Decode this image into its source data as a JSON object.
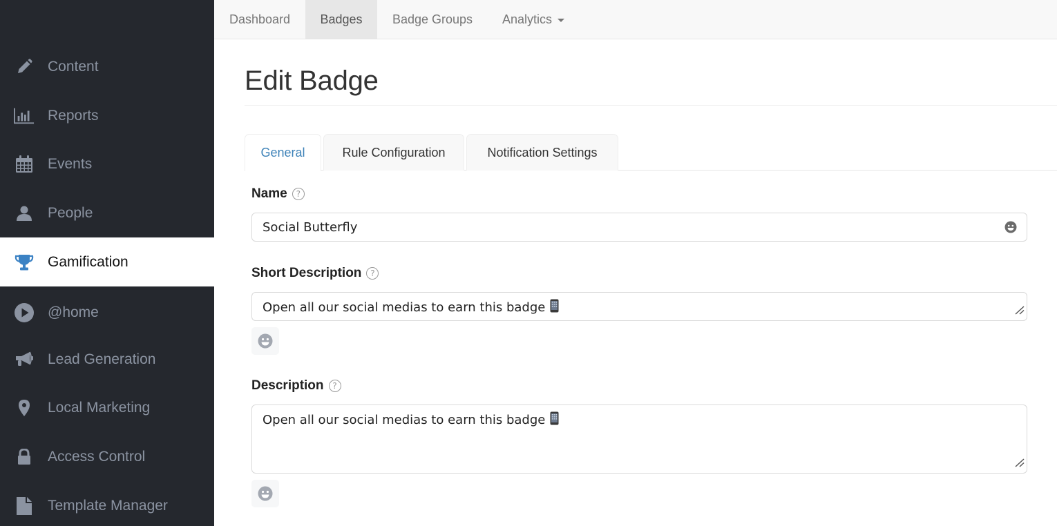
{
  "sidebar": {
    "items": [
      {
        "label": "Content",
        "icon": "pencil-icon",
        "active": false
      },
      {
        "label": "Reports",
        "icon": "bar-chart-icon",
        "active": false
      },
      {
        "label": "Events",
        "icon": "calendar-icon",
        "active": false
      },
      {
        "label": "People",
        "icon": "user-icon",
        "active": false
      },
      {
        "label": "Gamification",
        "icon": "trophy-icon",
        "active": true
      },
      {
        "label": "@home",
        "icon": "play-circle-icon",
        "active": false
      },
      {
        "label": "Lead Generation",
        "icon": "megaphone-icon",
        "active": false
      },
      {
        "label": "Local Marketing",
        "icon": "map-marker-icon",
        "active": false
      },
      {
        "label": "Access Control",
        "icon": "lock-icon",
        "active": false
      },
      {
        "label": "Template Manager",
        "icon": "file-icon",
        "active": false
      }
    ]
  },
  "topnav": {
    "items": [
      {
        "label": "Dashboard",
        "active": false
      },
      {
        "label": "Badges",
        "active": true
      },
      {
        "label": "Badge Groups",
        "active": false
      },
      {
        "label": "Analytics",
        "active": false,
        "dropdown": true
      }
    ]
  },
  "page": {
    "title": "Edit Badge"
  },
  "tabs": [
    {
      "label": "General",
      "active": true
    },
    {
      "label": "Rule Configuration",
      "active": false
    },
    {
      "label": "Notification Settings",
      "active": false
    }
  ],
  "form": {
    "name": {
      "label": "Name",
      "help": "?",
      "value": "Social Butterfly"
    },
    "short_description": {
      "label": "Short Description",
      "help": "?",
      "value": "Open all our social medias to earn this badge"
    },
    "description": {
      "label": "Description",
      "help": "?",
      "value": "Open all our social medias to earn this badge"
    }
  },
  "colors": {
    "sidebar_bg": "#25282e",
    "sidebar_text": "#8b93a1",
    "accent": "#3d82b8",
    "trophy": "#3b82c4"
  }
}
